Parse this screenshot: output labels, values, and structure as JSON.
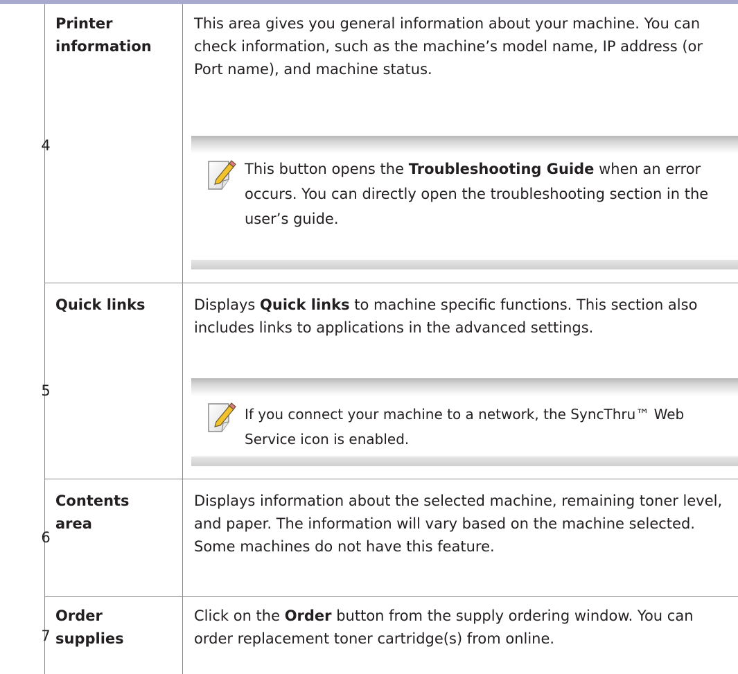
{
  "rows": [
    {
      "number": "4",
      "term_lines": [
        "Printer",
        "information"
      ],
      "description": "This area gives you general information about your machine. You can check information, such as the machine’s model name, IP address (or Port name), and machine status.",
      "note": {
        "icon": "note-pencil-icon",
        "before": "This button opens the ",
        "bold": "Troubleshooting Guide",
        "after": " when an error occurs. You can directly open the troubleshooting section in the user’s guide."
      }
    },
    {
      "number": "5",
      "term_lines": [
        "Quick links"
      ],
      "description_before": "Displays ",
      "description_bold": "Quick links",
      "description_after": " to machine specific functions. This section also includes links to applications in the advanced settings.",
      "note": {
        "icon": "note-pencil-icon",
        "text": "If you connect your machine to a network, the SyncThru™ Web Service icon is enabled."
      }
    },
    {
      "number": "6",
      "term_lines": [
        "Contents",
        "area"
      ],
      "description": "Displays information about the selected machine, remaining toner level, and paper. The information will vary based on the machine selected. Some machines do not have this feature."
    },
    {
      "number": "7",
      "term_lines": [
        "Order",
        "supplies"
      ],
      "description_before": "Click on the ",
      "description_bold": "Order",
      "description_after": " button from the supply ordering window. You can order replacement toner cartridge(s) from online."
    }
  ],
  "colors": {
    "top_rule": "#a9a9cf",
    "grid_line": "#8b8b8b",
    "note_band": "#cfcfcf",
    "icon_accent": "#f2c12e"
  }
}
